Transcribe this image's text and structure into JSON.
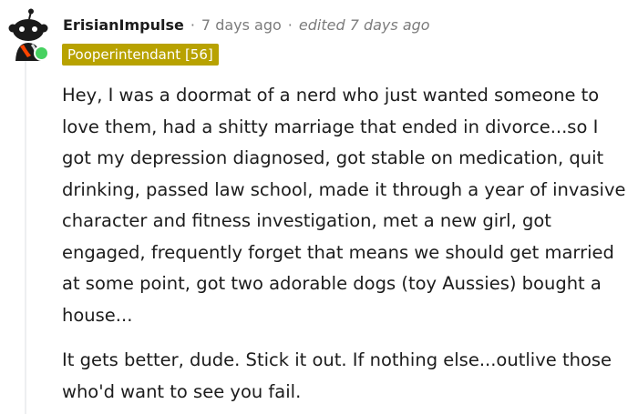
{
  "comment": {
    "author": "ErisianImpulse",
    "separator": "·",
    "timestamp": "7 days ago",
    "edited": "edited 7 days ago",
    "flair": "Pooperintendant [56]",
    "paragraphs": [
      "Hey, I was a doormat of a nerd who just wanted someone to love them, had a shitty marriage that ended in divorce...so I got my depression diagnosed, got stable on medication, quit drinking, passed law school, made it through a year of invasive character and fitness investigation, met a new girl, got engaged, frequently forget that means we should get married at some point, got two adorable dogs (toy Aussies) bought a house...",
      "It gets better, dude. Stick it out. If nothing else...outlive those who'd want to see you fail."
    ],
    "online_status_color": "#46d160",
    "flair_color": "#b8a200"
  }
}
